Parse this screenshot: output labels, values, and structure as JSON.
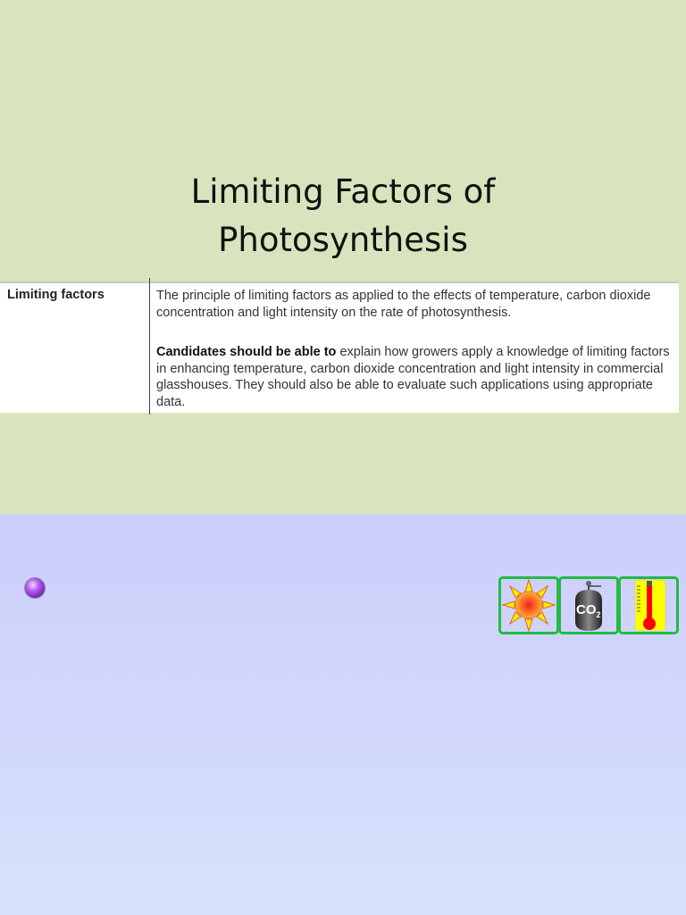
{
  "slide": {
    "title_line1": "Limiting Factors of",
    "title_line2": "Photosynthesis",
    "spec": {
      "label": "Limiting factors",
      "text1": "The principle of limiting factors as applied to the effects of temperature, carbon dioxide concentration and light intensity on the rate of photosynthesis.",
      "text2_bold": "Candidates should be able to",
      "text2_rest": " explain how growers apply a knowledge of limiting factors in enhancing temperature, carbon dioxide concentration and light intensity in commercial glasshouses.  They should also be able to evaluate such applications using appropriate data."
    },
    "icons": [
      "sun-icon",
      "co2-cylinder-icon",
      "thermometer-icon"
    ],
    "co2_label": "CO",
    "co2_sub": "2"
  }
}
